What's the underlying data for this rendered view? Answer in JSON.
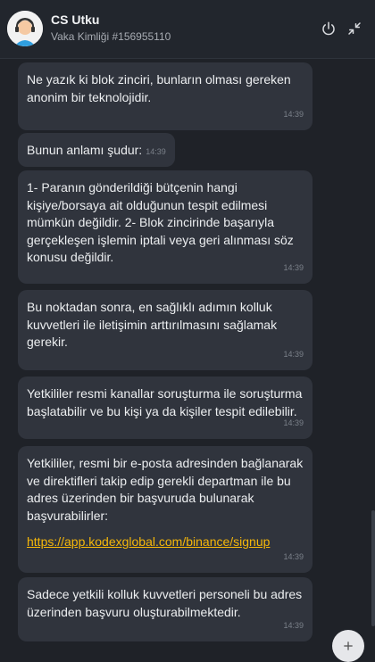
{
  "header": {
    "title": "CS Utku",
    "case_id": "Vaka Kimliği #156955110"
  },
  "messages": [
    {
      "text": "Ne yazık ki blok zinciri, bunların olması gereken anonim bir teknolojidir.",
      "time": "14:39"
    },
    {
      "text": "Bunun anlamı şudur:",
      "time": "14:39"
    },
    {
      "text": "1- Paranın gönderildiği bütçenin hangi kişiye/borsaya ait olduğunun tespit edilmesi mümkün değildir. 2- Blok zincirinde başarıyla gerçekleşen işlemin iptali veya geri alınması söz konusu değildir.",
      "time": "14:39"
    },
    {
      "text": "Bu noktadan sonra, en sağlıklı adımın kolluk kuvvetleri ile iletişimin arttırılmasını sağlamak gerekir.",
      "time": "14:39"
    },
    {
      "text": "Yetkililer resmi kanallar soruşturma ile soruşturma başlatabilir ve bu kişi ya da kişiler tespit edilebilir.",
      "time": "14:39"
    },
    {
      "text": "Yetkililer, resmi bir e-posta adresinden bağlanarak ve direktifleri takip edip gerekli departman ile bu adres üzerinden bir başvuruda bulunarak başvurabilirler:",
      "link": "https://app.kodexglobal.com/binance/signup",
      "time": "14:39"
    },
    {
      "text": "Sadece yetkili kolluk kuvvetleri personeli bu adres üzerinden başvuru oluşturabilmektedir.",
      "time": "14:39"
    }
  ],
  "icons": {
    "power": "power-icon",
    "minimize": "minimize-icon",
    "avatar": "support-agent-avatar",
    "fab": "add-icon"
  },
  "colors": {
    "background": "#1f2228",
    "bubble": "#30343d",
    "link": "#f5b70a"
  }
}
